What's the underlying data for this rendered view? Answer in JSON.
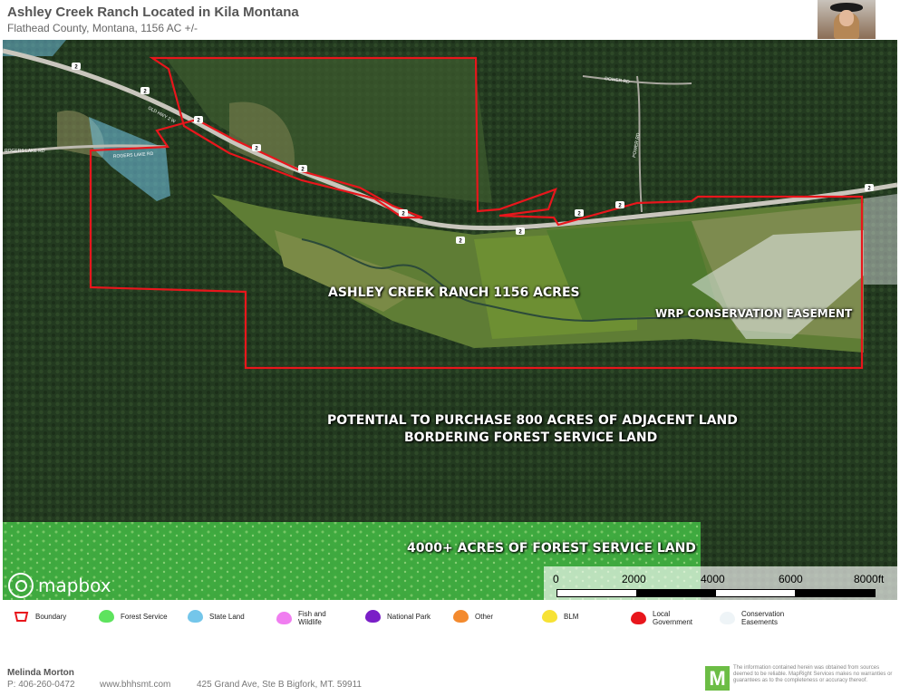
{
  "header": {
    "title": "Ashley Creek Ranch Located in  Kila Montana",
    "subtitle": "Flathead County, Montana, 1156 AC +/-"
  },
  "map": {
    "labels": {
      "ranch": "ASHLEY CREEK RANCH 1156 ACRES",
      "wrp": "WRP CONSERVATION EASEMENT",
      "potential_line1": "POTENTIAL TO PURCHASE 800 ACRES OF ADJACENT LAND",
      "potential_line2": "BORDERING FOREST SERVICE LAND",
      "forest": "4000+ ACRES OF FOREST SERVICE LAND"
    },
    "roads": {
      "rogers_lake_rd": "ROGERS LAKE RD",
      "dower_rd": "DOWER RD",
      "powell_rd": "POWER RD",
      "old_hwy": "OLD HWY 2 W"
    },
    "route_shield": "2",
    "attribution": "mapbox",
    "scale": {
      "ticks": [
        "0",
        "2000",
        "4000",
        "6000",
        "8000ft"
      ]
    },
    "colors": {
      "boundary": "#e8161c",
      "forest_service": "#4bd34b",
      "state_land": "#74c6ea",
      "conservation": "#e9eef0"
    }
  },
  "legend": [
    {
      "label": "Boundary",
      "icon": "boundary-icon",
      "color": "#e8161c"
    },
    {
      "label": "Forest Service",
      "icon": "forest-service-swatch",
      "color": "#5ee35e"
    },
    {
      "label": "State Land",
      "icon": "state-land-swatch",
      "color": "#74c6ea"
    },
    {
      "label": "Fish and Wildlife",
      "icon": "fish-wildlife-swatch",
      "color": "#f07ef0"
    },
    {
      "label": "National Park",
      "icon": "national-park-swatch",
      "color": "#7a1fc7"
    },
    {
      "label": "Other",
      "icon": "other-swatch",
      "color": "#f38a2e"
    },
    {
      "label": "BLM",
      "icon": "blm-swatch",
      "color": "#f7e235"
    },
    {
      "label": "Local Government",
      "icon": "local-government-swatch",
      "color": "#e8161c"
    },
    {
      "label": "Conservation Easements",
      "icon": "conservation-easement-swatch",
      "color": "#eef4f7"
    }
  ],
  "footer": {
    "agent_name": "Melinda  Morton",
    "phone": "P: 406-260-0472",
    "website": "www.bhhsmt.com",
    "address": "425 Grand Ave, Ste B Bigfork, MT. 59911",
    "logo_letter": "M",
    "disclaimer": "The information contained herein was obtained from sources deemed to be reliable. MapRight Services makes no warranties or guarantees as to the completeness or accuracy thereof."
  }
}
